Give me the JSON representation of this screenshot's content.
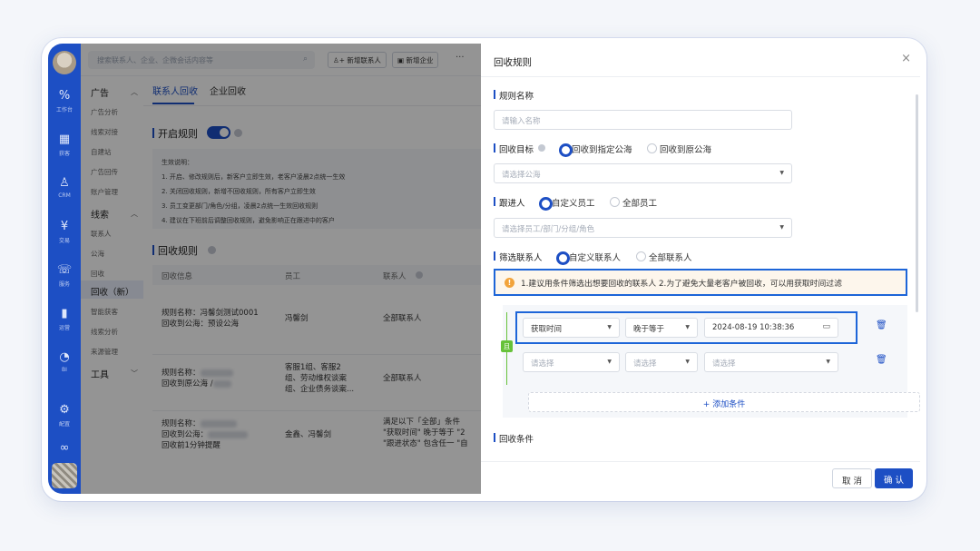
{
  "rail": {
    "items": [
      {
        "icon": "percent-icon",
        "glyph": "%",
        "label": "工作台"
      },
      {
        "icon": "chart-icon",
        "glyph": "▦",
        "label": "获客"
      },
      {
        "icon": "user-icon",
        "glyph": "♙",
        "label": "CRM"
      },
      {
        "icon": "yen-icon",
        "glyph": "¥",
        "label": "交易"
      },
      {
        "icon": "headset-icon",
        "glyph": "☏",
        "label": "服务"
      },
      {
        "icon": "bars-icon",
        "glyph": "▮",
        "label": "运营"
      },
      {
        "icon": "pie-icon",
        "glyph": "◔",
        "label": "BI"
      },
      {
        "icon": "gear-icon",
        "glyph": "⚙",
        "label": "配置"
      },
      {
        "icon": "infinity-icon",
        "glyph": "∞",
        "label": ""
      }
    ]
  },
  "topbar": {
    "search_placeholder": "搜索联系人、企业、企微会话内容等",
    "add_contact": "新增联系人",
    "add_company": "新增企业",
    "more": "···"
  },
  "submenu": {
    "groups": [
      {
        "label": "广告",
        "items": [
          "广告分析",
          "线索对接",
          "自建站",
          "广告回传",
          "账户管理"
        ]
      },
      {
        "label": "线索",
        "items": [
          "联系人",
          "公海",
          "回收",
          "回收（新）",
          "智能获客",
          "线索分析",
          "来源管理"
        ]
      },
      {
        "label": "工具",
        "items": []
      }
    ]
  },
  "content": {
    "tabs": [
      "联系人回收",
      "企业回收"
    ],
    "rule_switch_title": "开启规则",
    "desc_lines": [
      "生效说明：",
      "1. 开启、修改规则后，新客户立即生效，老客户凌晨2点统一生效",
      "2. 关闭回收规则，新增不回收规则，所有客户立即生效",
      "3. 员工变更部门/角色/分组，凌晨2点统一生效回收规则",
      "4. 建议在下班前后调整回收规则，避免影响正在跟进中的客户"
    ],
    "rule_list_title": "回收规则",
    "table_headers": [
      "回收信息",
      "员工",
      "联系人"
    ],
    "rows": [
      {
        "info": [
          "规则名称：冯馨剑测试0001",
          "回收到公海：预设公海"
        ],
        "staff": [
          "冯馨剑"
        ],
        "contact": [
          "全部联系人"
        ]
      },
      {
        "info": [
          "规则名称：",
          "回收到原公海 /"
        ],
        "staff": [
          "客服1组、客服2",
          "组、劳动维权谈案",
          "组、企业债务谈案..."
        ],
        "contact": [
          "全部联系人"
        ]
      },
      {
        "info": [
          "规则名称：",
          "回收到公海：",
          "回收前1分钟提醒"
        ],
        "staff": [
          "金鑫、冯馨剑"
        ],
        "contact": [
          "满足以下「全部」条件",
          "\"获取时间\" 晚于等于 \"2",
          "\"跟进状态\" 包含任一 \"自"
        ]
      }
    ]
  },
  "drawer": {
    "title": "回收规则",
    "close": "×",
    "rule_name_label": "规则名称",
    "rule_name_placeholder": "请输入名称",
    "target_label": "回收目标",
    "target_options": [
      "回收到指定公海",
      "回收到原公海"
    ],
    "pool_placeholder": "请选择公海",
    "follower_label": "跟进人",
    "follower_options": [
      "自定义员工",
      "全部员工"
    ],
    "staff_placeholder": "请选择员工/部门/分组/角色",
    "filter_label": "筛选联系人",
    "filter_options": [
      "自定义联系人",
      "全部联系人"
    ],
    "tip": "1.建议用条件筛选出想要回收的联系人 2.为了避免大量老客户被回收，可以用获取时间过滤",
    "and_badge": "且",
    "conditions": [
      {
        "field": "获取时间",
        "op": "晚于等于",
        "value": "2024-08-19 10:38:36"
      },
      {
        "field": "请选择",
        "op": "请选择",
        "value": "请选择"
      }
    ],
    "add_condition": "+ 添加条件",
    "recycle_condition_label": "回收条件",
    "cancel": "取 消",
    "confirm": "确 认"
  }
}
